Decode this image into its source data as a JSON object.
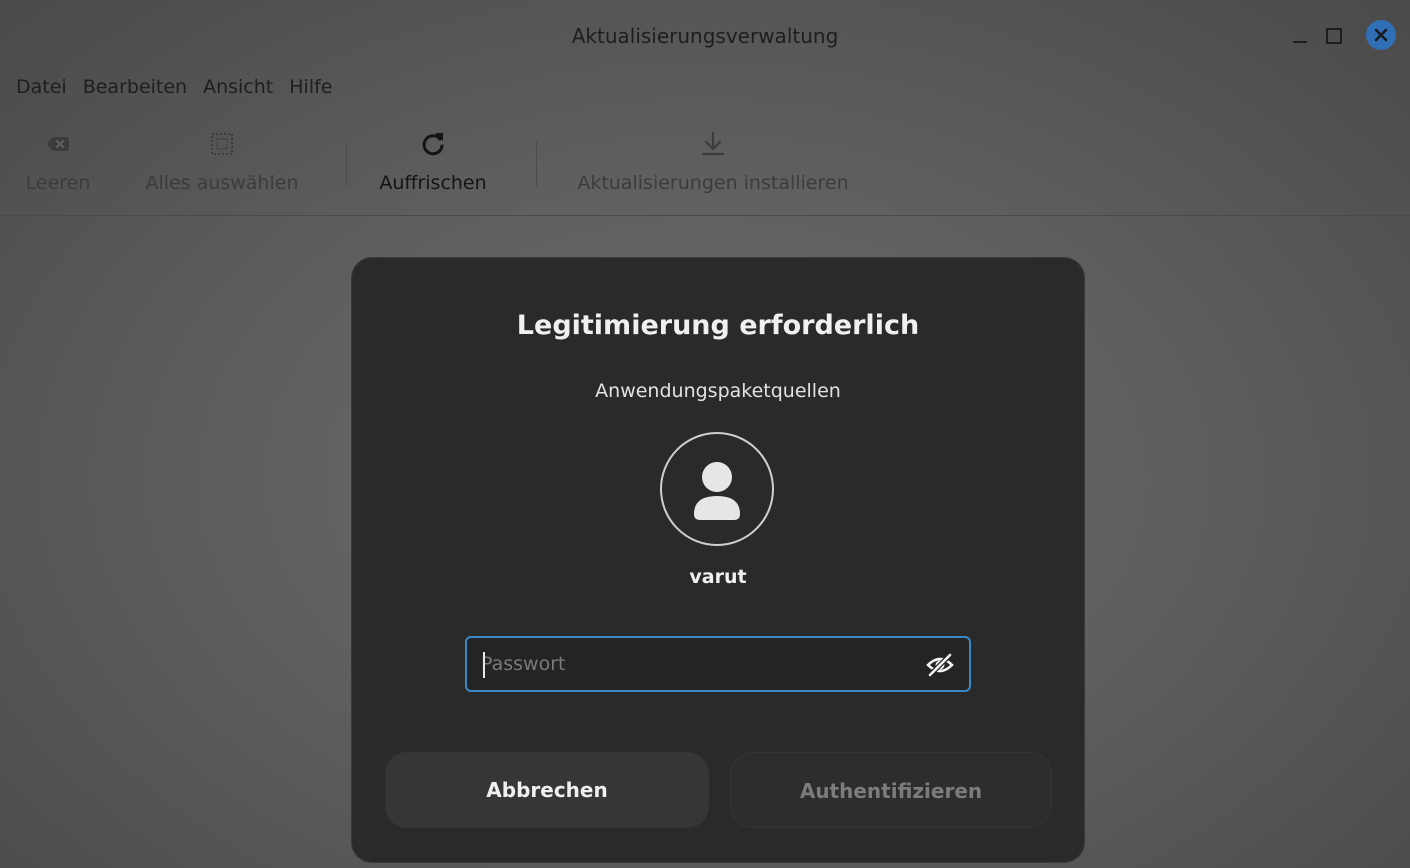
{
  "window": {
    "title": "Aktualisierungsverwaltung",
    "close_color": "#2f6fb6"
  },
  "menubar": {
    "items": [
      "Datei",
      "Bearbeiten",
      "Ansicht",
      "Hilfe"
    ]
  },
  "toolbar": {
    "buttons": [
      {
        "label": "Leeren",
        "icon": "clear-icon",
        "enabled": false
      },
      {
        "label": "Alles auswählen",
        "icon": "select-all-icon",
        "enabled": false
      },
      {
        "label": "Auffrischen",
        "icon": "refresh-icon",
        "enabled": true
      },
      {
        "label": "Aktualisierungen installieren",
        "icon": "download-icon",
        "enabled": false
      }
    ]
  },
  "dialog": {
    "title": "Legitimierung erforderlich",
    "subtitle": "Anwendungspaketquellen",
    "avatar_icon": "user-icon",
    "username": "varut",
    "password": {
      "value": "",
      "placeholder": "Passwort",
      "toggle_icon": "eye-slash-icon"
    },
    "cancel_label": "Abbrechen",
    "authenticate_label": "Authentifizieren",
    "accent_color": "#3b88c7"
  }
}
